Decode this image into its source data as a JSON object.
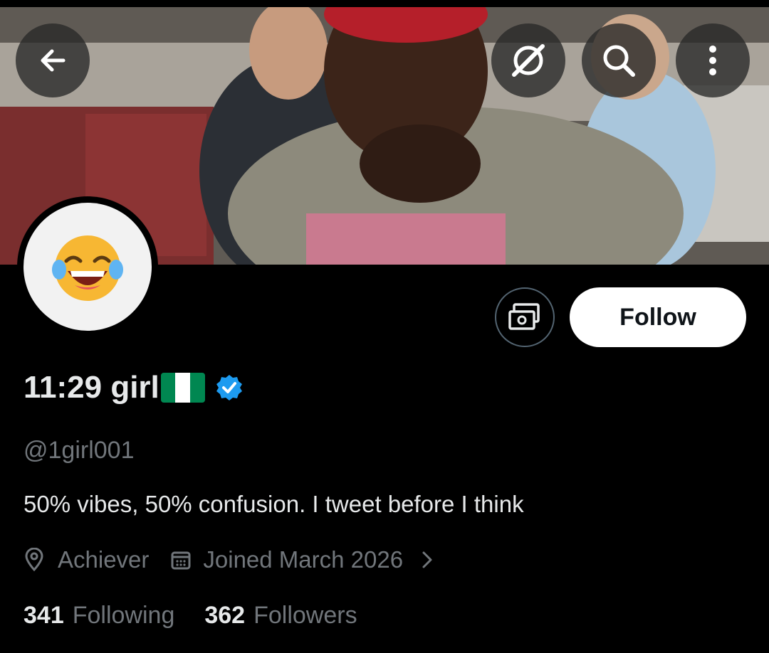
{
  "header": {
    "back_icon": "arrow-left-icon",
    "grok_icon": "grok-slash-icon",
    "search_icon": "search-icon",
    "more_icon": "more-vertical-icon"
  },
  "profile": {
    "avatar_emoji": "😂",
    "display_name": "11:29 girl",
    "flag_colors": [
      "#008751",
      "#ffffff",
      "#008751"
    ],
    "verified_color": "#1d9bf0",
    "handle": "@1girl001",
    "bio": "50% vibes, 50% confusion. I tweet before I think",
    "location": "Achiever",
    "joined": "Joined March 2026",
    "following_count": "341",
    "following_label": "Following",
    "followers_count": "362",
    "followers_label": "Followers"
  },
  "actions": {
    "follow_label": "Follow",
    "tip_icon": "tip-money-icon"
  }
}
